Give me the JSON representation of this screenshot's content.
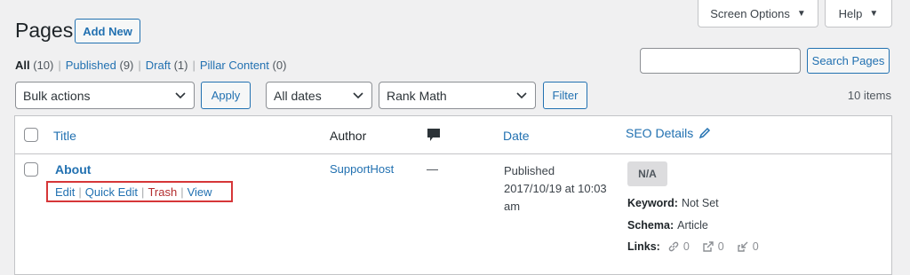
{
  "top_tabs": {
    "screen_options": "Screen Options",
    "help": "Help"
  },
  "header": {
    "title": "Pages",
    "add_new": "Add New"
  },
  "views": [
    {
      "label": "All",
      "count": "(10)",
      "current": true
    },
    {
      "label": "Published",
      "count": "(9)"
    },
    {
      "label": "Draft",
      "count": "(1)"
    },
    {
      "label": "Pillar Content",
      "count": "(0)"
    }
  ],
  "search": {
    "value": "",
    "button": "Search Pages"
  },
  "tablenav": {
    "bulk_actions": "Bulk actions",
    "apply": "Apply",
    "dates": "All dates",
    "rank_math": "Rank Math",
    "filter": "Filter",
    "items_count": "10 items"
  },
  "table": {
    "headers": {
      "title": "Title",
      "author": "Author",
      "date": "Date",
      "seo": "SEO Details"
    },
    "rows": [
      {
        "title": "About",
        "actions": {
          "edit": "Edit",
          "quick_edit": "Quick Edit",
          "trash": "Trash",
          "view": "View"
        },
        "author": "SupportHost",
        "comments": "—",
        "date_status": "Published",
        "date_value": "2017/10/19 at 10:03",
        "date_time": "am",
        "seo": {
          "score": "N/A",
          "keyword_label": "Keyword:",
          "keyword_value": "Not Set",
          "schema_label": "Schema:",
          "schema_value": "Article",
          "links_label": "Links:",
          "internal": "0",
          "external": "0",
          "incoming": "0"
        }
      }
    ]
  },
  "colors": {
    "accent": "#2271b1",
    "highlight_border": "#d63638",
    "background": "#f0f0f1"
  }
}
